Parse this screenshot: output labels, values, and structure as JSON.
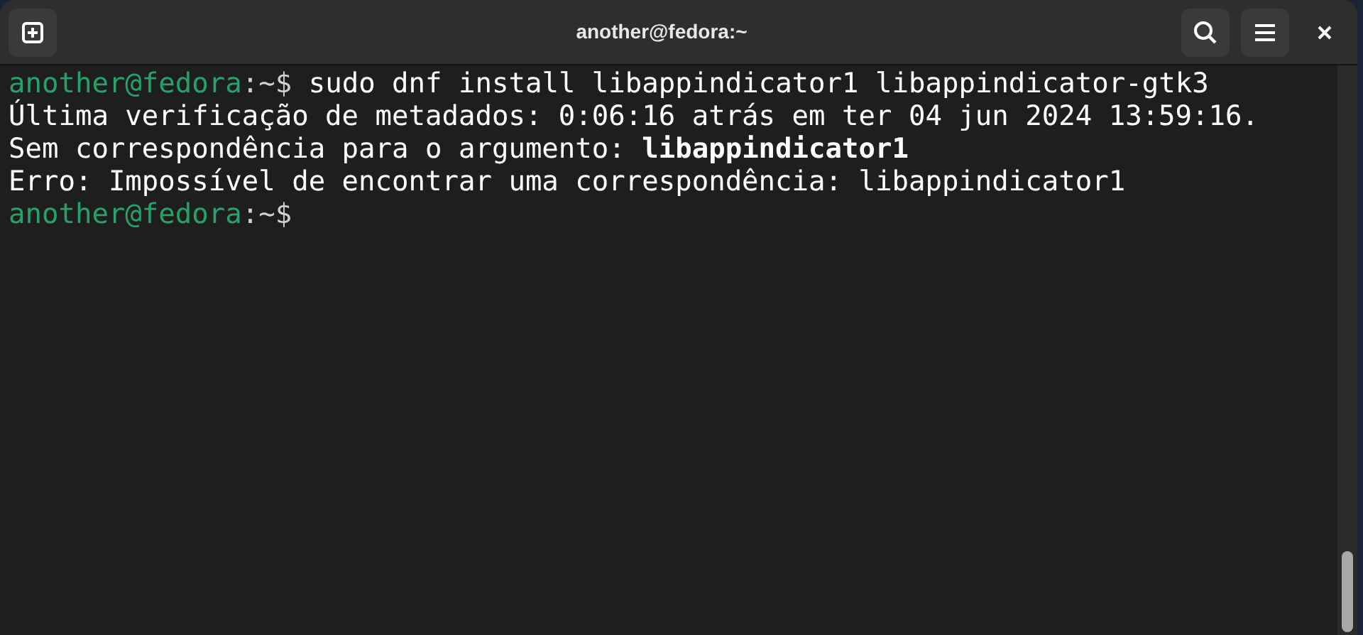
{
  "window": {
    "title": "another@fedora:~"
  },
  "terminal": {
    "lines": [
      {
        "kind": "prompt",
        "user_host": "another@fedora",
        "path": ":~$",
        "command": "sudo dnf install libappindicator1 libappindicator-gtk3"
      },
      {
        "kind": "output",
        "text": "Última verificação de metadados: 0:06:16 atrás em ter 04 jun 2024 13:59:16."
      },
      {
        "kind": "output",
        "text": "Sem correspondência para o argumento: **libappindicator1**"
      },
      {
        "kind": "output",
        "text": "Erro: Impossível de encontrar uma correspondência: libappindicator1"
      },
      {
        "kind": "prompt",
        "user_host": "another@fedora",
        "path": ":~$"
      }
    ]
  }
}
